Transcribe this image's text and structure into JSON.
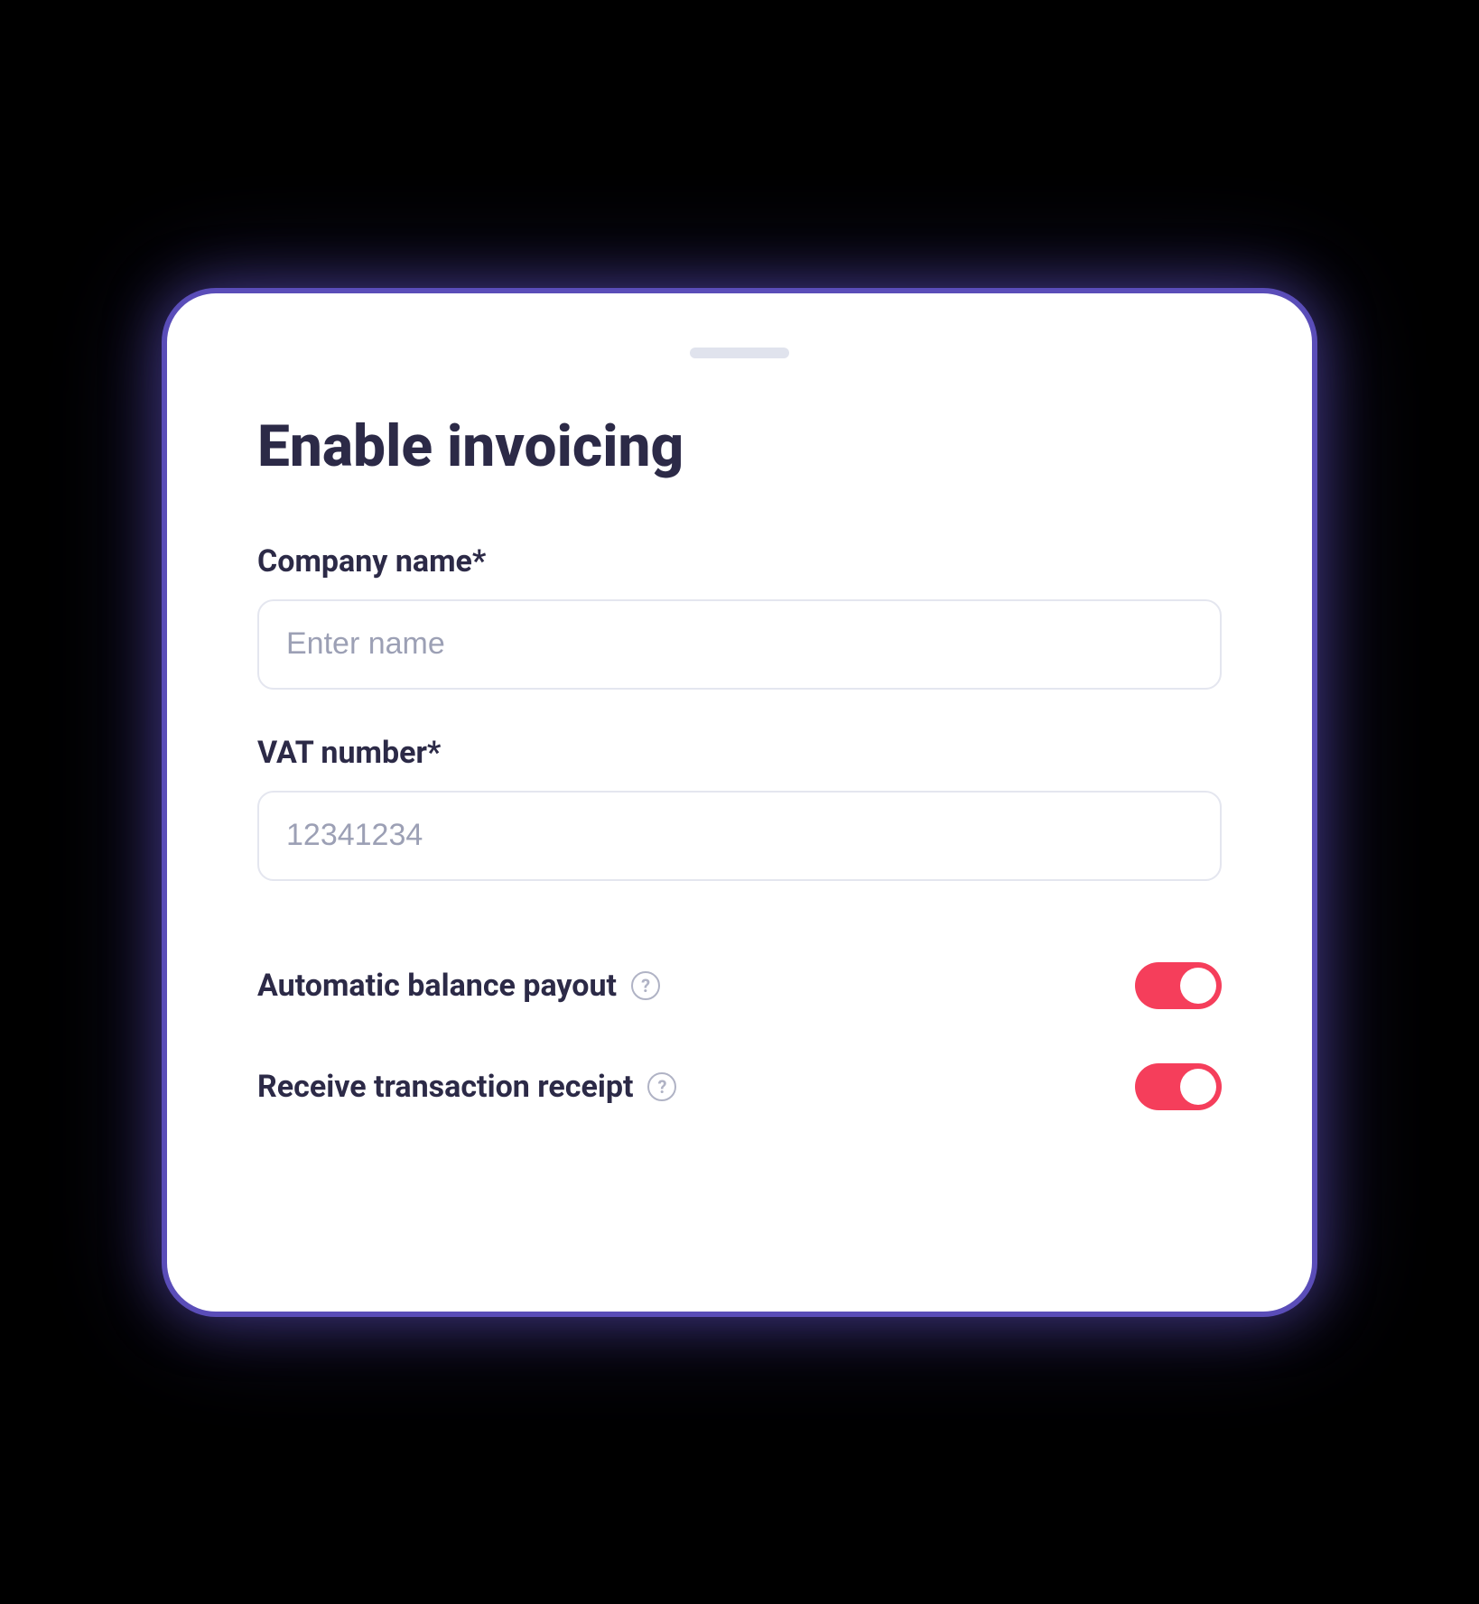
{
  "title": "Enable invoicing",
  "fields": {
    "company": {
      "label": "Company name*",
      "placeholder": "Enter name",
      "value": ""
    },
    "vat": {
      "label": "VAT number*",
      "placeholder": "12341234",
      "value": ""
    }
  },
  "toggles": {
    "autoPayout": {
      "label": "Automatic balance payout",
      "helpGlyph": "?",
      "on": true
    },
    "receipt": {
      "label": "Receive transaction receipt",
      "helpGlyph": "?",
      "on": true
    }
  }
}
